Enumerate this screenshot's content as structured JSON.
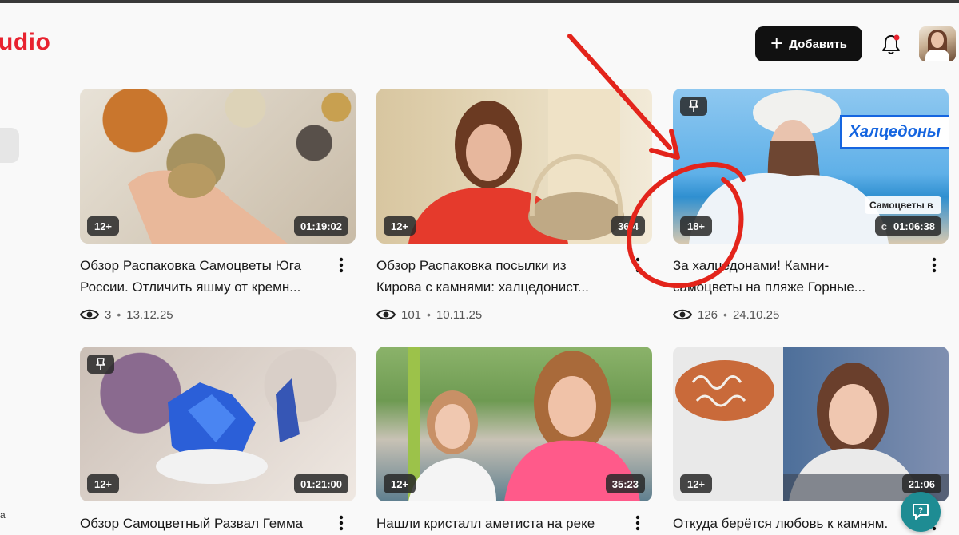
{
  "app": {
    "logo_text": "udio",
    "brand_color": "#e8222f",
    "sidebar_letter": "а"
  },
  "header": {
    "add_button_label": "Добавить",
    "add_icon": "plus-icon",
    "notification_icon": "bell-icon",
    "notification_dot_color": "#e8222f"
  },
  "videos": [
    {
      "title_line1": "Обзор Распаковка Самоцветы Юга",
      "title_line2": "России. Отличить яшму от кремн...",
      "age": "12+",
      "duration": "01:19:02",
      "views": "3",
      "date": "13.12.25",
      "pinned": false
    },
    {
      "title_line1": "Обзор Распаковка посылки из",
      "title_line2": "Кирова с камнями: халцедонист...",
      "age": "12+",
      "duration": "36:4",
      "views": "101",
      "date": "10.11.25",
      "pinned": false
    },
    {
      "title_line1": "За халцедонами! Камни-",
      "title_line2": "самоцветы на пляже Горные...",
      "age": "18+",
      "duration": "01:06:38",
      "views": "126",
      "date": "24.10.25",
      "pinned": true,
      "thumb_caption": "Халцедоны",
      "thumb_caption_small": "Самоцветы в",
      "thumb_caption_small2": "с"
    },
    {
      "title_line1": "Обзор Самоцветный Развал Гемма",
      "age": "12+",
      "duration": "01:21:00",
      "pinned": true
    },
    {
      "title_line1": "Нашли кристалл аметиста на реке",
      "age": "12+",
      "duration": "35:23",
      "pinned": false
    },
    {
      "title_line1": "Откуда берётся любовь к камням.",
      "age": "12+",
      "duration": "21:06",
      "pinned": false
    }
  ],
  "icons": {
    "views": "eye-icon",
    "more": "kebab-menu-icon",
    "pin": "pin-icon",
    "help": "chat-help-icon"
  },
  "annotation_color": "#e3241b"
}
